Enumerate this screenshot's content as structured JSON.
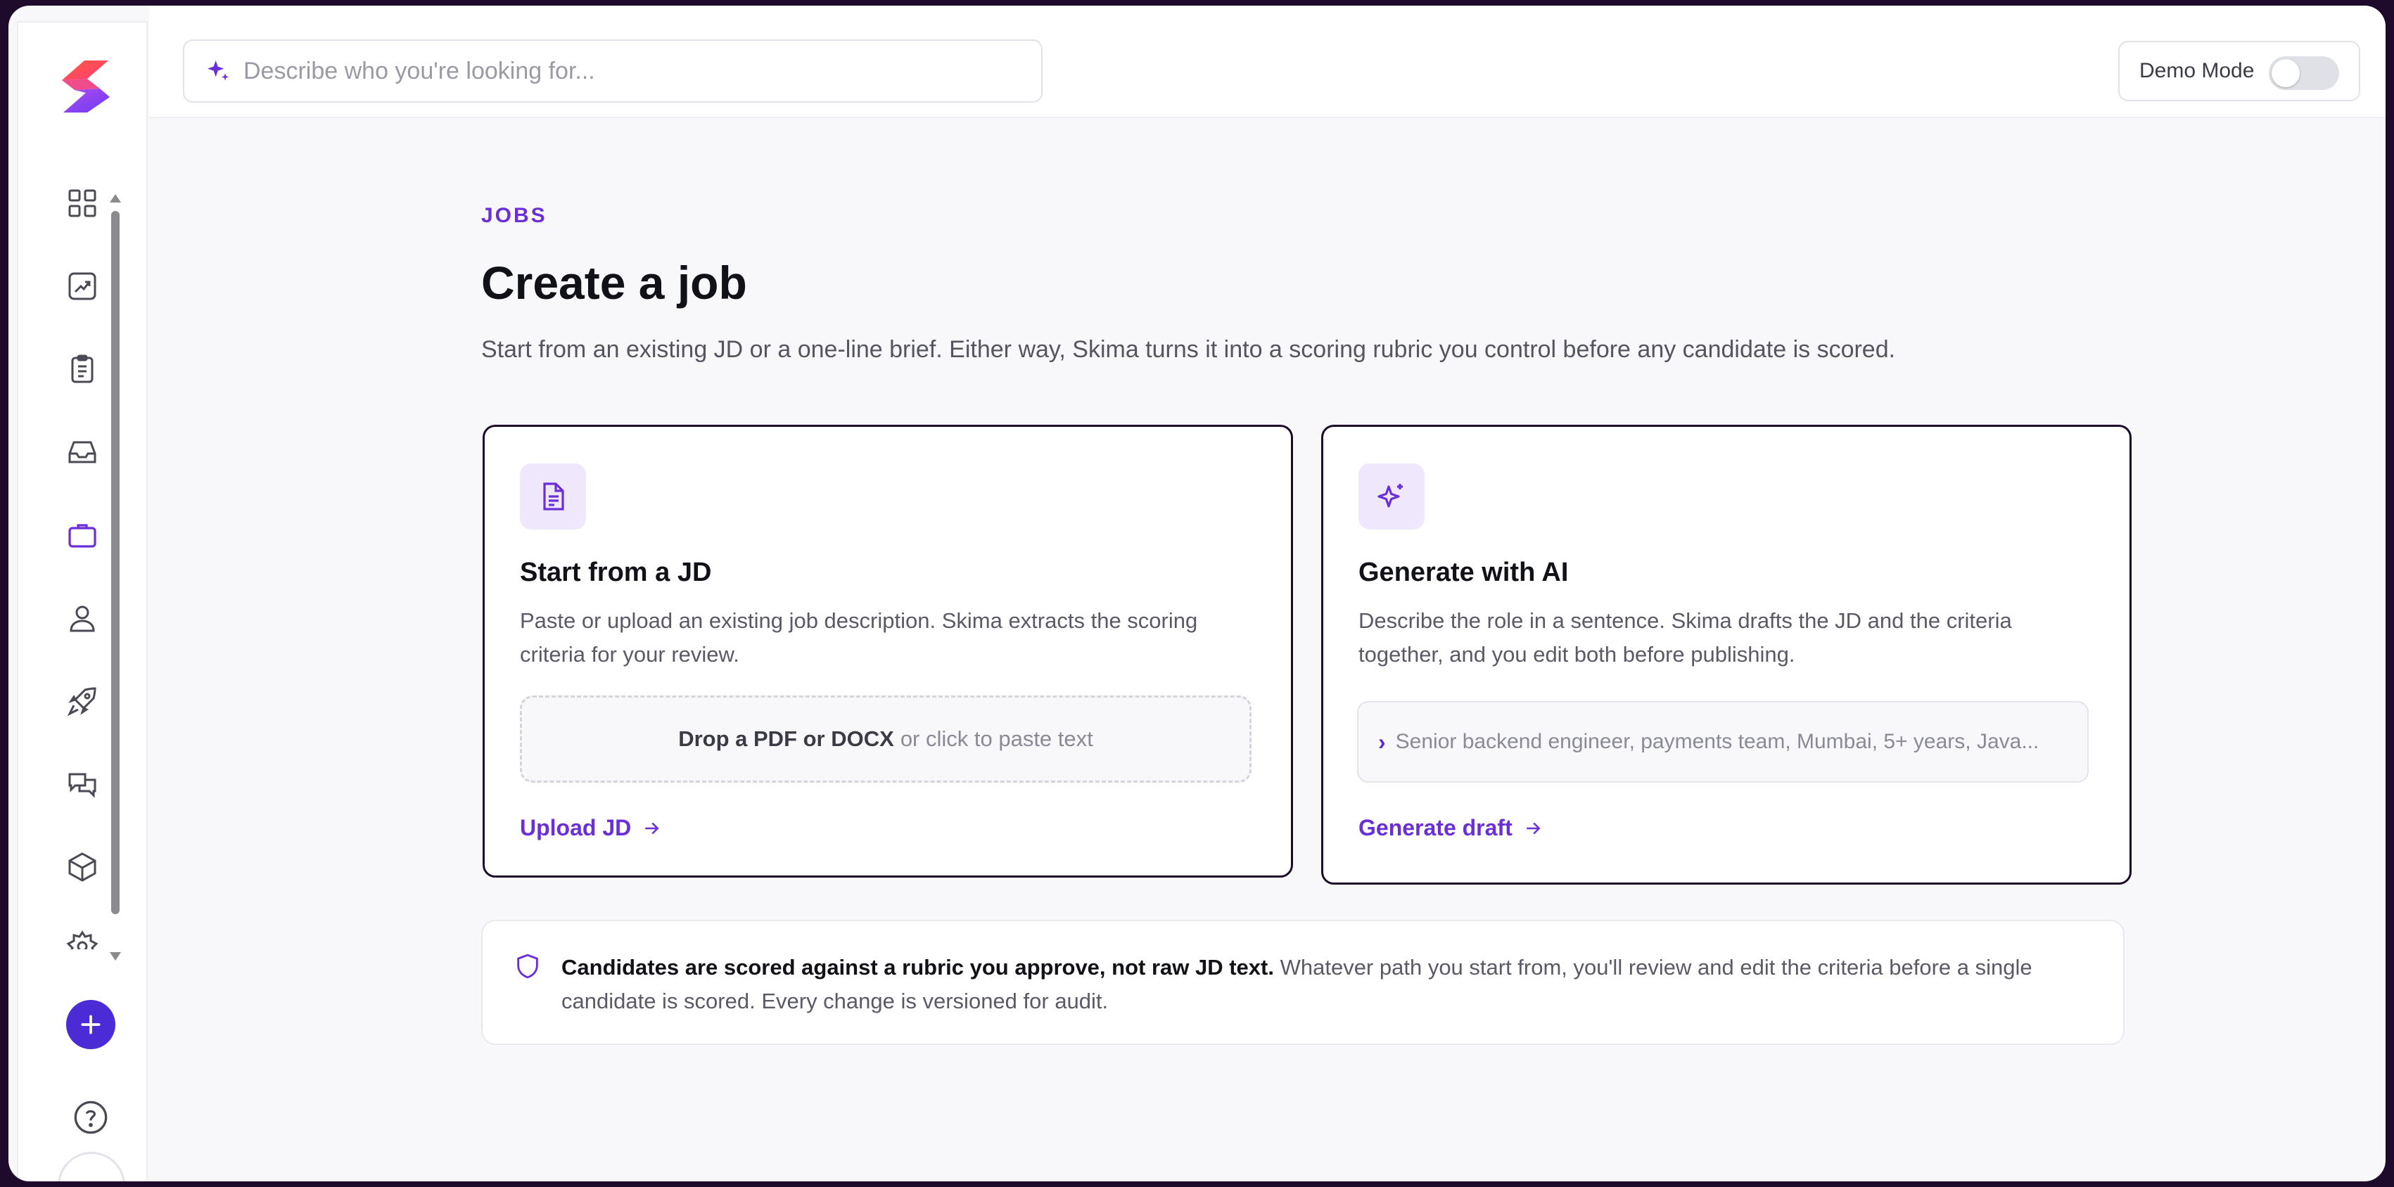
{
  "topbar": {
    "search_placeholder": "Describe who you're looking for...",
    "demo_mode_label": "Demo Mode",
    "demo_mode_on": false
  },
  "sidebar": {
    "items": [
      {
        "icon": "grid-icon",
        "label": "Dashboard"
      },
      {
        "icon": "trending-chart-icon",
        "label": "Analytics"
      },
      {
        "icon": "clipboard-list-icon",
        "label": "Tasks"
      },
      {
        "icon": "inbox-icon",
        "label": "Inbox"
      },
      {
        "icon": "briefcase-icon",
        "label": "Jobs",
        "active": true
      },
      {
        "icon": "user-icon",
        "label": "Candidates"
      },
      {
        "icon": "rocket-icon",
        "label": "Launch"
      },
      {
        "icon": "chat-bubbles-icon",
        "label": "Messages"
      },
      {
        "icon": "cube-icon",
        "label": "Integrations"
      },
      {
        "icon": "gear-icon",
        "label": "Settings"
      }
    ]
  },
  "page": {
    "eyebrow": "JOBS",
    "title": "Create a job",
    "subtitle": "Start from an existing JD or a one-line brief. Either way, Skima turns it into a scoring rubric you control before any candidate is scored."
  },
  "cards": {
    "jd": {
      "title": "Start from a JD",
      "description": "Paste or upload an existing job description. Skima extracts the scoring criteria for your review.",
      "drop_bold": "Drop a PDF or DOCX",
      "drop_rest": "or click to paste text",
      "link": "Upload JD"
    },
    "ai": {
      "title": "Generate with AI",
      "description": "Describe the role in a sentence. Skima drafts the JD and the criteria together, and you edit both before publishing.",
      "prompt_example": "Senior backend engineer, payments team, Mumbai, 5+ years, Java...",
      "link": "Generate draft"
    }
  },
  "notice": {
    "bold": "Candidates are scored against a rubric you approve, not raw JD text.",
    "rest": "Whatever path you start from, you'll review and edit the criteria before a single candidate is scored. Every change is versioned for audit."
  },
  "colors": {
    "accent": "#6b2fd8",
    "primary_button": "#4a2bd6",
    "card_border": "#1c0c2a"
  }
}
